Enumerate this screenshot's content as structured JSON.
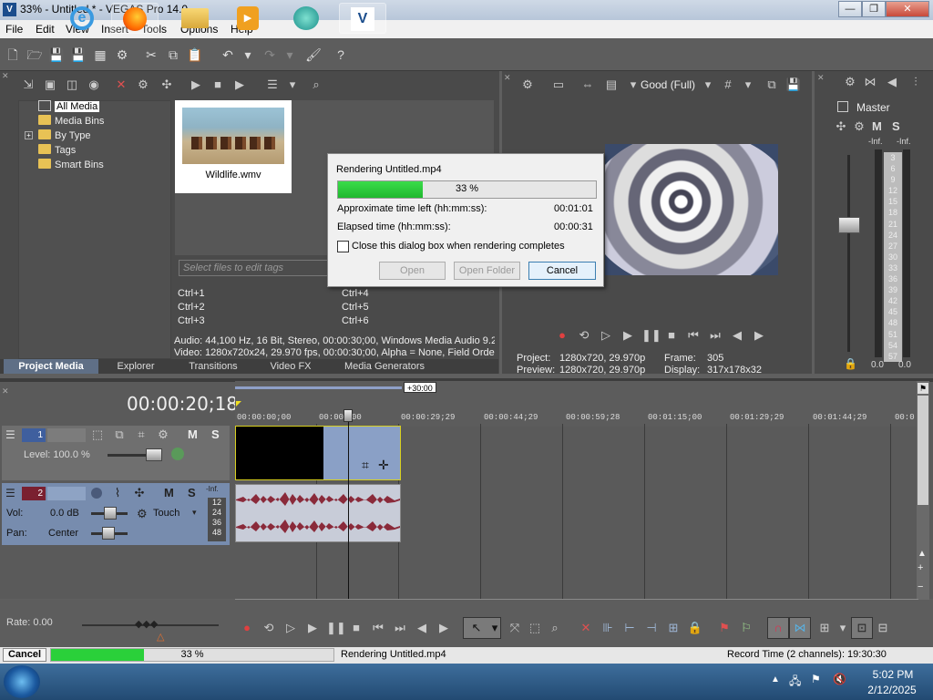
{
  "window": {
    "title": "33% - Untitled * - VEGAS Pro 14.0",
    "min": "—",
    "max": "❐",
    "close": "✕"
  },
  "menu": [
    "File",
    "Edit",
    "View",
    "Insert",
    "Tools",
    "Options",
    "Help"
  ],
  "project_media": {
    "tree": [
      "All Media",
      "Media Bins",
      "By Type",
      "Tags",
      "Smart Bins"
    ],
    "expander": "+",
    "thumbnail_label": "Wildlife.wmv",
    "tag_placeholder": "Select files to edit tags",
    "shortcuts_left": [
      "Ctrl+1",
      "Ctrl+2",
      "Ctrl+3"
    ],
    "shortcuts_right": [
      "Ctrl+4",
      "Ctrl+5",
      "Ctrl+6"
    ],
    "audio_info": "Audio: 44,100 Hz, 16 Bit, Stereo, 00:00:30;00, Windows Media Audio 9.2",
    "video_info": "Video: 1280x720x24, 29.970 fps, 00:00:30;00, Alpha = None, Field Orde",
    "tabs": [
      "Project Media",
      "Explorer",
      "Transitions",
      "Video FX",
      "Media Generators"
    ]
  },
  "render_dialog": {
    "title": "Rendering Untitled.mp4",
    "progress_text": "33 %",
    "progress": 0.33,
    "time_left_label": "Approximate time left (hh:mm:ss):",
    "time_left_value": "00:01:01",
    "elapsed_label": "Elapsed time (hh:mm:ss):",
    "elapsed_value": "00:00:31",
    "checkbox_label": "Close this dialog box when rendering completes",
    "open_btn": "Open",
    "open_folder_btn": "Open Folder",
    "cancel_btn": "Cancel"
  },
  "preview": {
    "quality": "Good (Full)",
    "project_label": "Project:",
    "project_value": "1280x720, 29.970p",
    "preview_label": "Preview:",
    "preview_value": "1280x720, 29.970p",
    "frame_label": "Frame:",
    "frame_value": "305",
    "display_label": "Display:",
    "display_value": "317x178x32"
  },
  "master": {
    "label": "Master",
    "m": "M",
    "s": "S",
    "inf_l": "-Inf.",
    "inf_r": "-Inf.",
    "scale": [
      "3",
      "6",
      "9",
      "12",
      "15",
      "18",
      "21",
      "24",
      "27",
      "30",
      "33",
      "36",
      "39",
      "42",
      "45",
      "48",
      "51",
      "54",
      "57"
    ],
    "bottom_l": "0.0",
    "bottom_r": "0.0"
  },
  "timeline": {
    "timecode": "00:00:20;18",
    "marker": "+30:00",
    "ruler": [
      "00:00:00;00",
      "00:00:1",
      "00",
      "00:00:29;29",
      "00:00:44;29",
      "00:00:59;28",
      "00:01:15;00",
      "00:01:29;29",
      "00:01:44;29",
      "00:0"
    ],
    "video_track": {
      "num": "1",
      "level": "Level: 100.0 %",
      "m": "M",
      "s": "S"
    },
    "audio_track": {
      "num": "2",
      "vol_label": "Vol:",
      "vol_value": "0.0 dB",
      "pan_label": "Pan:",
      "pan_value": "Center",
      "automation": "Touch",
      "m": "M",
      "s": "S",
      "meter": [
        "-Inf.",
        "12",
        "24",
        "36",
        "48"
      ]
    },
    "rate": "Rate: 0.00"
  },
  "status": {
    "cancel": "Cancel",
    "progress_text": "33 %",
    "progress": 0.33,
    "message": "Rendering Untitled.mp4",
    "record_time": "Record Time (2 channels): 19:30:30"
  },
  "taskbar": {
    "time": "5:02 PM",
    "date": "2/12/2025"
  }
}
